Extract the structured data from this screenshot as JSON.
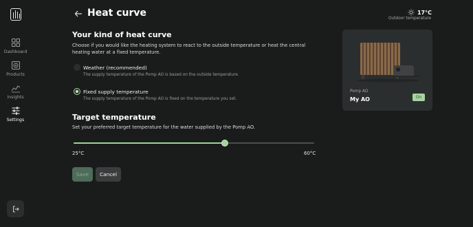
{
  "sidebar": {
    "items": [
      {
        "label": "Dashboard",
        "icon": "grid-icon"
      },
      {
        "label": "Products",
        "icon": "product-icon"
      },
      {
        "label": "Insights",
        "icon": "chart-icon"
      },
      {
        "label": "Settings",
        "icon": "sliders-icon",
        "active": true
      }
    ]
  },
  "header": {
    "title": "Heat curve",
    "weather_temp": "17°C",
    "weather_label": "Outdoor temperature"
  },
  "curve": {
    "heading": "Your kind of heat curve",
    "description": "Choose if you would like the heating system to react to the outside temperature or heat the central heating water at a fixed temperature.",
    "options": [
      {
        "label": "Weather (recommended)",
        "description": "The supply temperature of the Pomp AO is based on the outside temperature.",
        "selected": false
      },
      {
        "label": "Fixed supply temperature",
        "description": "The supply temperature of the Pomp AO is fixed on the temperature you set.",
        "selected": true
      }
    ]
  },
  "target": {
    "heading": "Target temperature",
    "description": "Set your preferred target temperature for the water supplied by the Pomp AO.",
    "min_label": "25°C",
    "max_label": "60°C",
    "min": 25,
    "max": 60,
    "value": 47
  },
  "actions": {
    "save_label": "Save",
    "cancel_label": "Cancel"
  },
  "product": {
    "subtitle": "Pomp AO",
    "name": "My AO",
    "status": "On"
  },
  "colors": {
    "accent": "#9fd49a",
    "background": "#1a1c1c",
    "card": "#2b2e2e"
  }
}
